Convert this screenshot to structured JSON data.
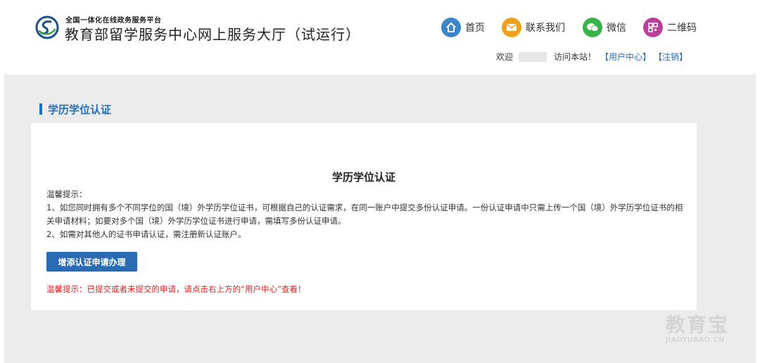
{
  "header": {
    "platform_label": "全国一体化在线政务服务平台",
    "site_title": "教育部留学服务中心网上服务大厅（试运行）",
    "nav": {
      "home": "首页",
      "contact": "联系我们",
      "wechat": "微信",
      "qrcode": "二维码"
    },
    "welcome_prefix": "欢迎",
    "welcome_suffix": "访问本站！",
    "user_center": "【用户中心】",
    "logout": "【注销】"
  },
  "section": {
    "title": "学历学位认证"
  },
  "card": {
    "title": "学历学位认证",
    "tips_heading": "温馨提示：",
    "tip1": "1、如您同时拥有多个不同学位的国（境）外学历学位证书，可根据自己的认证需求，在同一账户中提交多份认证申请。一份认证申请中只需上传一个国（境）外学历学位证书的相关申请材料；如要对多个国（境）外学历学位证书进行申请，需填写多份认证申请。",
    "tip2": "2、如需对其他人的证书申请认证，需注册新认证账户。",
    "apply_button": "增添认证申请办理",
    "warning": "温馨提示：已提交或者未提交的申请，请点击右上方的“用户中心”查看！"
  },
  "watermark": {
    "cn": "教育宝",
    "en": "JIAOYUBAO.CN"
  },
  "colors": {
    "accent": "#1d6fc0",
    "button": "#2a6bb3",
    "warning": "#e02020",
    "home_icon": "#3a86c8",
    "contact_icon": "#f0a020",
    "wechat_icon": "#3ab34a",
    "qrcode_icon": "#b8409a"
  },
  "icons": {
    "logo": "ministry-logo-icon",
    "home": "home-icon",
    "contact": "mail-icon",
    "wechat": "wechat-icon",
    "qrcode": "qrcode-icon"
  }
}
